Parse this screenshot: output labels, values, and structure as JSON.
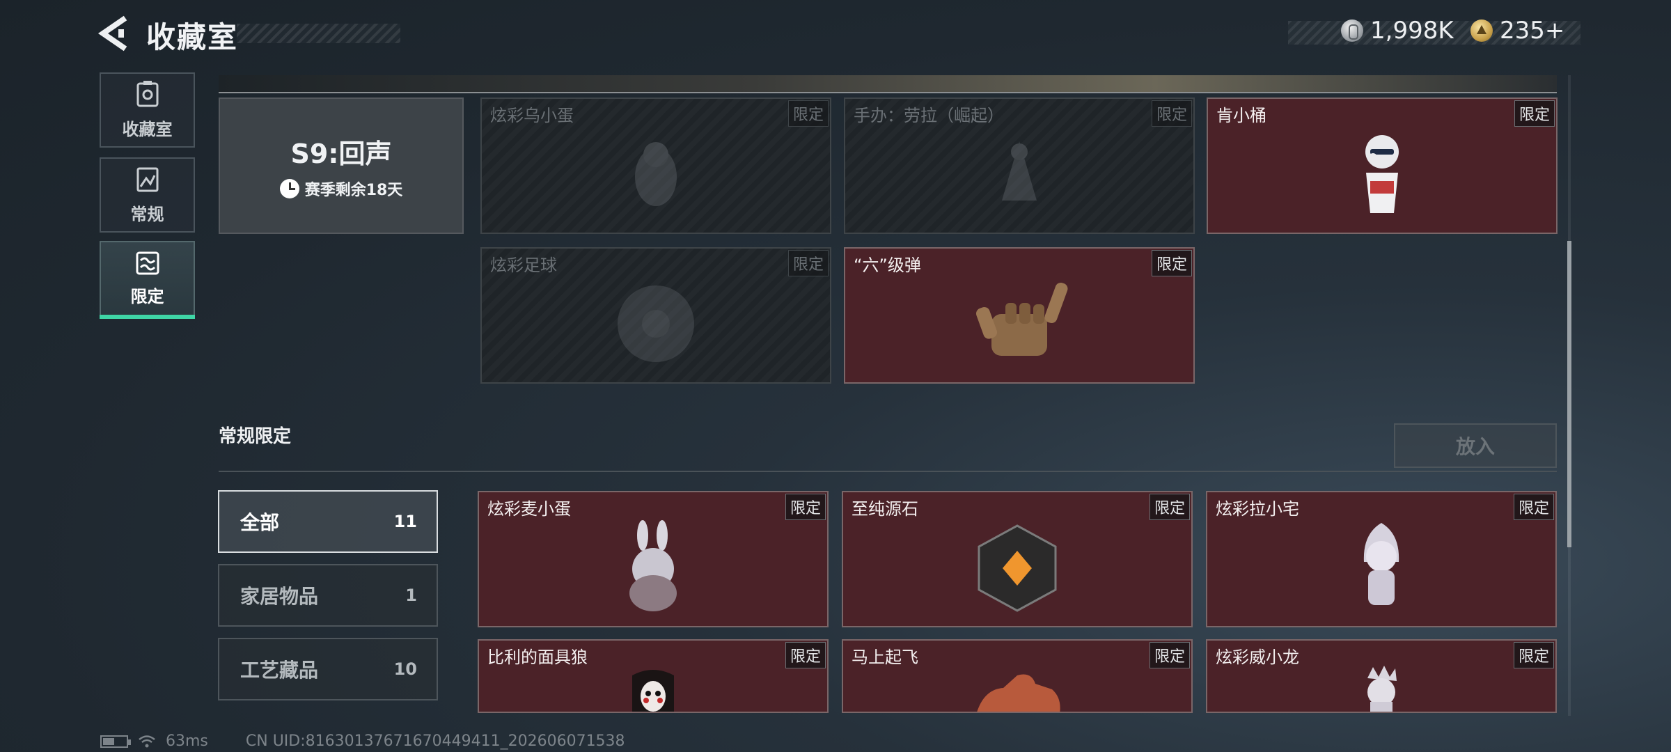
{
  "header": {
    "title": "收藏室",
    "currency": [
      {
        "icon": "silver-coin-icon",
        "value": "1,998K"
      },
      {
        "icon": "gold-coin-icon",
        "value": "235+"
      }
    ]
  },
  "nav": {
    "items": [
      {
        "label": "收藏室",
        "icon": "collection-icon",
        "active": false
      },
      {
        "label": "常规",
        "icon": "regular-icon",
        "active": false
      },
      {
        "label": "限定",
        "icon": "limited-icon",
        "active": true
      }
    ]
  },
  "season": {
    "name": "S9:回声",
    "remaining": "赛季剩余18天"
  },
  "season_items": [
    {
      "name": "炫彩乌小蛋",
      "badge": "限定",
      "owned": false
    },
    {
      "name": "手办：劳拉（崛起）",
      "badge": "限定",
      "owned": false
    },
    {
      "name": "肯小桶",
      "badge": "限定",
      "owned": true
    },
    {
      "name": "炫彩足球",
      "badge": "限定",
      "owned": false
    },
    {
      "name": "“六”级弹",
      "badge": "限定",
      "owned": true
    }
  ],
  "regular_limited": {
    "title": "常规限定",
    "place_button": "放入",
    "filters": [
      {
        "label": "全部",
        "count": "11",
        "active": true
      },
      {
        "label": "家居物品",
        "count": "1",
        "active": false
      },
      {
        "label": "工艺藏品",
        "count": "10",
        "active": false
      }
    ],
    "items": [
      {
        "name": "炫彩麦小蛋",
        "badge": "限定"
      },
      {
        "name": "至纯源石",
        "badge": "限定"
      },
      {
        "name": "炫彩拉小宅",
        "badge": "限定"
      },
      {
        "name": "比利的面具狼",
        "badge": "限定"
      },
      {
        "name": "马上起飞",
        "badge": "限定"
      },
      {
        "name": "炫彩威小龙",
        "badge": "限定"
      }
    ]
  },
  "status": {
    "ping": "63ms",
    "uid": "CN UID:816301376716704494​11_202606071538"
  },
  "colors": {
    "accent": "#3fd6a6",
    "owned_card": "#4b2228",
    "background": "#1f2830"
  }
}
